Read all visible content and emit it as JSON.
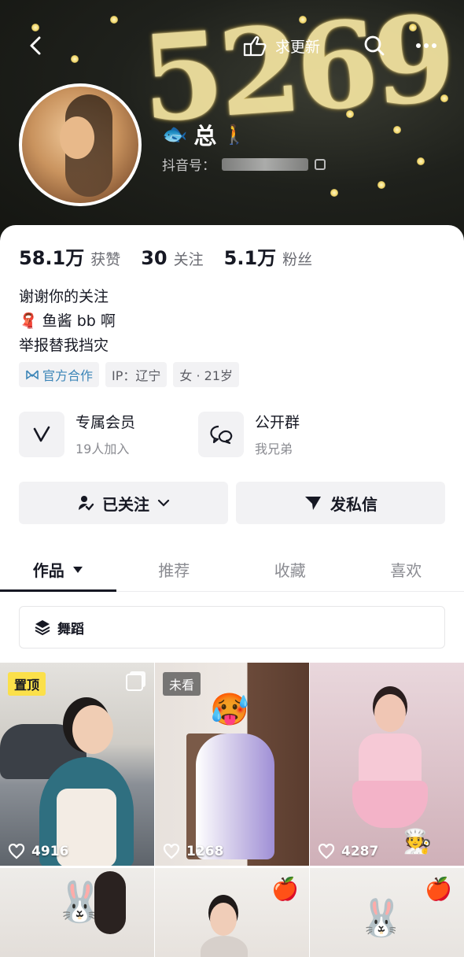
{
  "header": {
    "back_icon": "chevron-left-icon",
    "cover_text": "5269",
    "update_label": "求更新",
    "search_icon": "search-icon",
    "more_icon": "more-dots-icon"
  },
  "profile": {
    "nickname": "总",
    "nickname_prefix_emoji": "🐟",
    "nickname_suffix_emoji": "🚶",
    "douyin_id_label": "抖音号："
  },
  "stats": [
    {
      "value": "58.1万",
      "label": "获赞"
    },
    {
      "value": "30",
      "label": "关注"
    },
    {
      "value": "5.1万",
      "label": "粉丝"
    }
  ],
  "bio": {
    "line1": "谢谢你的关注",
    "line2_emoji": "🧣",
    "line2": "鱼酱 bb 啊",
    "line3": "举报替我挡灾"
  },
  "tags": {
    "official": "官方合作",
    "ip": "IP：辽宁",
    "gender_age": "女 · 21岁"
  },
  "features": {
    "member_title": "专属会员",
    "member_sub": "19人加入",
    "group_title": "公开群",
    "group_sub": "我兄弟"
  },
  "actions": {
    "followed_label": "已关注",
    "message_label": "发私信"
  },
  "tabs": {
    "works": "作品",
    "recommend": "推荐",
    "favorites": "收藏",
    "likes": "喜欢"
  },
  "filter_label": "舞蹈",
  "grid": {
    "pin_badge": "置顶",
    "unseen_badge": "未看",
    "like1": "4916",
    "like2": "1268",
    "like3": "4287"
  },
  "colors": {
    "official_tag": "#3d86b8",
    "pin_badge": "#fbe04a",
    "chip_bg": "#f2f2f4"
  }
}
